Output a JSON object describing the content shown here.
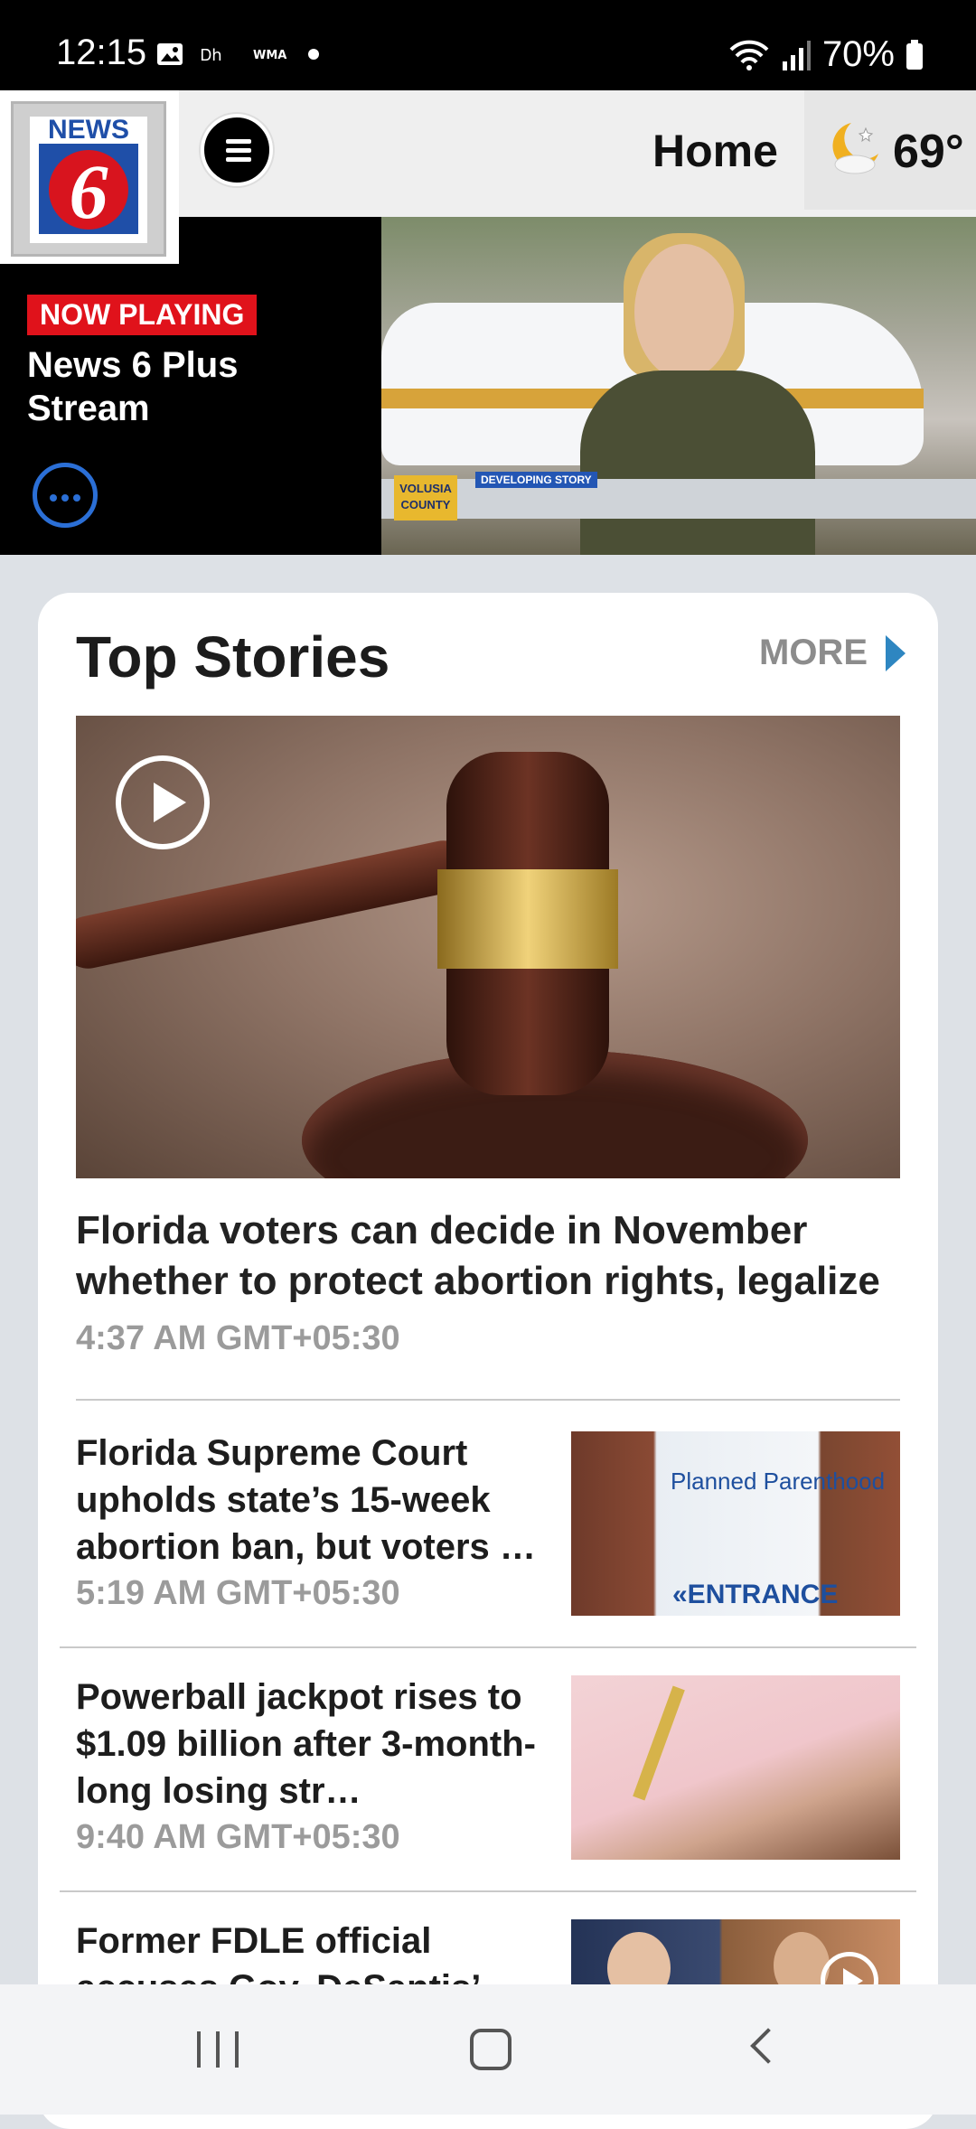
{
  "status_bar": {
    "time": "12:15",
    "battery": "70%",
    "notif_icons": [
      "image-icon",
      "dh-icon",
      "wma-icon",
      "dot-icon"
    ]
  },
  "header": {
    "logo_text": "NEWS",
    "logo_number": "6",
    "title": "Home",
    "temperature": "69°",
    "weather_icon": "moon-cloud-icon"
  },
  "player": {
    "badge": "NOW PLAYING",
    "title": "News 6 Plus Stream",
    "video_ticker": "DEVELOPING STORY",
    "video_county": "VOLUSIA COUNTY"
  },
  "top_stories": {
    "title": "Top Stories",
    "more_label": "MORE",
    "hero": {
      "headline": "Florida voters can decide in November whether to protect abortion rights, legalize recreation…",
      "time": "4:37 AM GMT+05:30"
    },
    "items": [
      {
        "headline": "Florida Supreme Court upholds state’s 15-week abortion ban, but voters …",
        "time": "5:19 AM GMT+05:30",
        "thumb_text_1": "Planned Parenthood",
        "thumb_text_2": "«ENTRANCE"
      },
      {
        "headline": "Powerball jackpot rises to $1.09 billion after 3-month-long losing str…",
        "time": "9:40 AM GMT+05:30"
      },
      {
        "headline": "Former FDLE official accuses Gov. DeSantis’",
        "time": ""
      }
    ]
  },
  "colors": {
    "accent_red": "#e0121b",
    "link_blue": "#2e86c1",
    "card_bg": "#ffffff",
    "page_bg": "#dde1e6"
  }
}
